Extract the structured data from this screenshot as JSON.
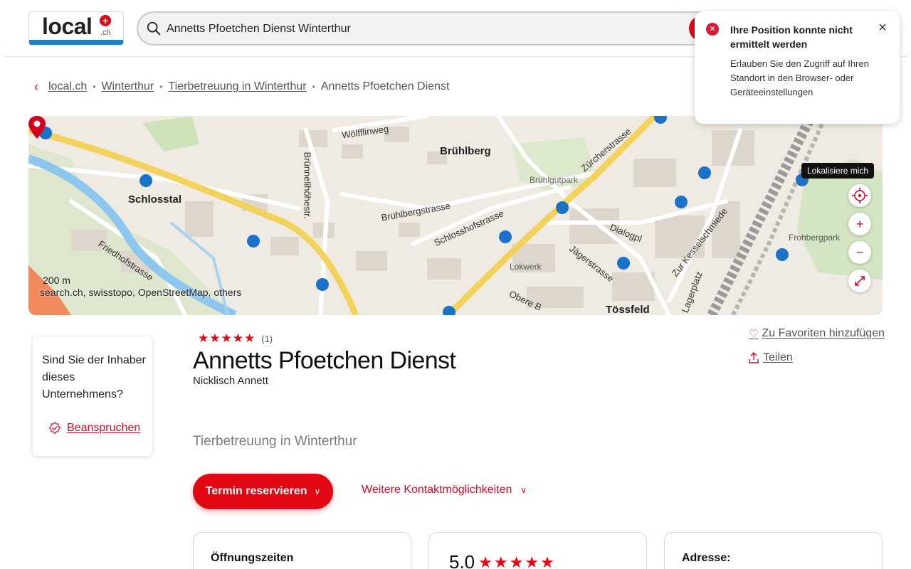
{
  "header": {
    "logo_text": "local",
    "logo_suffix": ".ch",
    "search_value": "Annetts Pfoetchen Dienst Winterthur"
  },
  "toast": {
    "title": "Ihre Position konnte nicht ermittelt werden",
    "body": "Erlauben Sie den Zugriff auf Ihren Standort in den Browser- oder Geräteeinstellungen",
    "close": "×"
  },
  "breadcrumb": {
    "items": [
      "local.ch",
      "Winterthur",
      "Tierbetreuung in Winterthur"
    ],
    "current": "Annetts Pfoetchen Dienst"
  },
  "map": {
    "labels": {
      "schlosstal": "Schlosstal",
      "bruehlberg": "Brühlberg",
      "toessfeld": "Tössfeld",
      "woelfflinweg": "Wölfflinweg",
      "bruehlbergstrasse": "Brühlbergstrasse",
      "schlosshofstrasse": "Schlosshofstrasse",
      "zuercherstrasse": "Zürcherstrasse",
      "bruehlgutpark": "Brühlgutpark",
      "dialogpl": "Dialogpl",
      "jaegerstrasse": "Jägerstrasse",
      "lokwerk": "Lokwerk",
      "frohbergpark": "Frohbergpark",
      "kesselschmiede": "Zur Kesselschmiede",
      "friedhofstrasse": "Friedhofstrasse",
      "bruennelihoehstr": "Brünnelihöhestr.",
      "lagerplatz": "Lagerplatz",
      "obere": "Obere B"
    },
    "scale": "200 m",
    "attribution": "search.ch, swisstopo, OpenStreetMap, others",
    "tooltip": "Lokalisiere mich",
    "zoom_in": "+",
    "zoom_out": "−"
  },
  "claim": {
    "question": "Sind Sie der Inhaber dieses Unternehmens?",
    "link": "Beanspruchen"
  },
  "business": {
    "rating_stars": 5,
    "rating_count": "(1)",
    "name": "Annetts Pfoetchen Dienst",
    "owner": "Nicklisch Annett",
    "category": "Tierbetreuung in Winterthur",
    "favorite": "Zu Favoriten hinzufügen",
    "share": "Teilen",
    "primary_button": "Termin reservieren",
    "secondary_button": "Weitere Kontaktmöglichkeiten"
  },
  "cards": {
    "hours_title": "Öffnungszeiten",
    "score": "5.0",
    "address_title": "Adresse:"
  },
  "colors": {
    "brand_red": "#e30613",
    "link_red": "#c8102e",
    "logo_blue": "#1f7fc4"
  }
}
